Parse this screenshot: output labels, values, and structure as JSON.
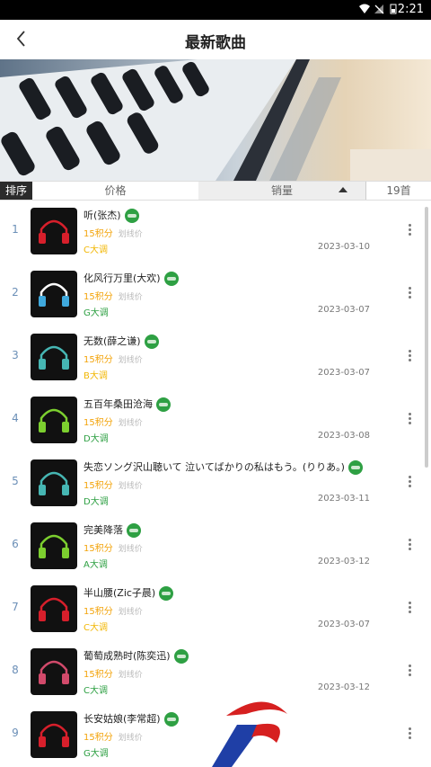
{
  "status_bar": {
    "time": "2:21"
  },
  "header": {
    "title": "最新歌曲"
  },
  "sort_bar": {
    "label": "排序",
    "price": "价格",
    "sales": "销量",
    "count": "19首"
  },
  "songs": [
    {
      "num": "1",
      "name": "听(张杰)",
      "price": "15积分",
      "strike": "划线价",
      "key": "C大调",
      "date": "2023-03-10",
      "key_color": "#f2b705",
      "headphone_color": "#d71f2b"
    },
    {
      "num": "2",
      "name": "化风行万里(大欢)",
      "price": "15积分",
      "strike": "划线价",
      "key": "G大调",
      "date": "2023-03-07",
      "key_color": "#2ea043",
      "headphone_color": "#3fa9dd"
    },
    {
      "num": "3",
      "name": "无数(薛之谦)",
      "price": "15积分",
      "strike": "划线价",
      "key": "B大调",
      "date": "2023-03-07",
      "key_color": "#f2b705",
      "headphone_color": "#46b6b3"
    },
    {
      "num": "4",
      "name": "五百年桑田沧海",
      "price": "15积分",
      "strike": "划线价",
      "key": "D大调",
      "date": "2023-03-08",
      "key_color": "#2ea043",
      "headphone_color": "#7ccf2f"
    },
    {
      "num": "5",
      "name": "失恋ソング沢山聴いて 泣いてばかりの私はもう。(りりあ。)",
      "price": "15积分",
      "strike": "划线价",
      "key": "D大调",
      "date": "2023-03-11",
      "key_color": "#2ea043",
      "headphone_color": "#46b6b3"
    },
    {
      "num": "6",
      "name": "完美降落",
      "price": "15积分",
      "strike": "划线价",
      "key": "A大调",
      "date": "2023-03-12",
      "key_color": "#2ea043",
      "headphone_color": "#7ccf2f"
    },
    {
      "num": "7",
      "name": "半山腰(Zic子晨)",
      "price": "15积分",
      "strike": "划线价",
      "key": "C大调",
      "date": "2023-03-07",
      "key_color": "#f2b705",
      "headphone_color": "#d71f2b"
    },
    {
      "num": "8",
      "name": "葡萄成熟时(陈奕迅)",
      "price": "15积分",
      "strike": "划线价",
      "key": "C大调",
      "date": "2023-03-12",
      "key_color": "#2ea043",
      "headphone_color": "#d24a6b"
    },
    {
      "num": "9",
      "name": "长安姑娘(李常超)",
      "price": "15积分",
      "strike": "划线价",
      "key": "G大调",
      "date": "",
      "key_color": "#2ea043",
      "headphone_color": "#d71f2b"
    }
  ]
}
